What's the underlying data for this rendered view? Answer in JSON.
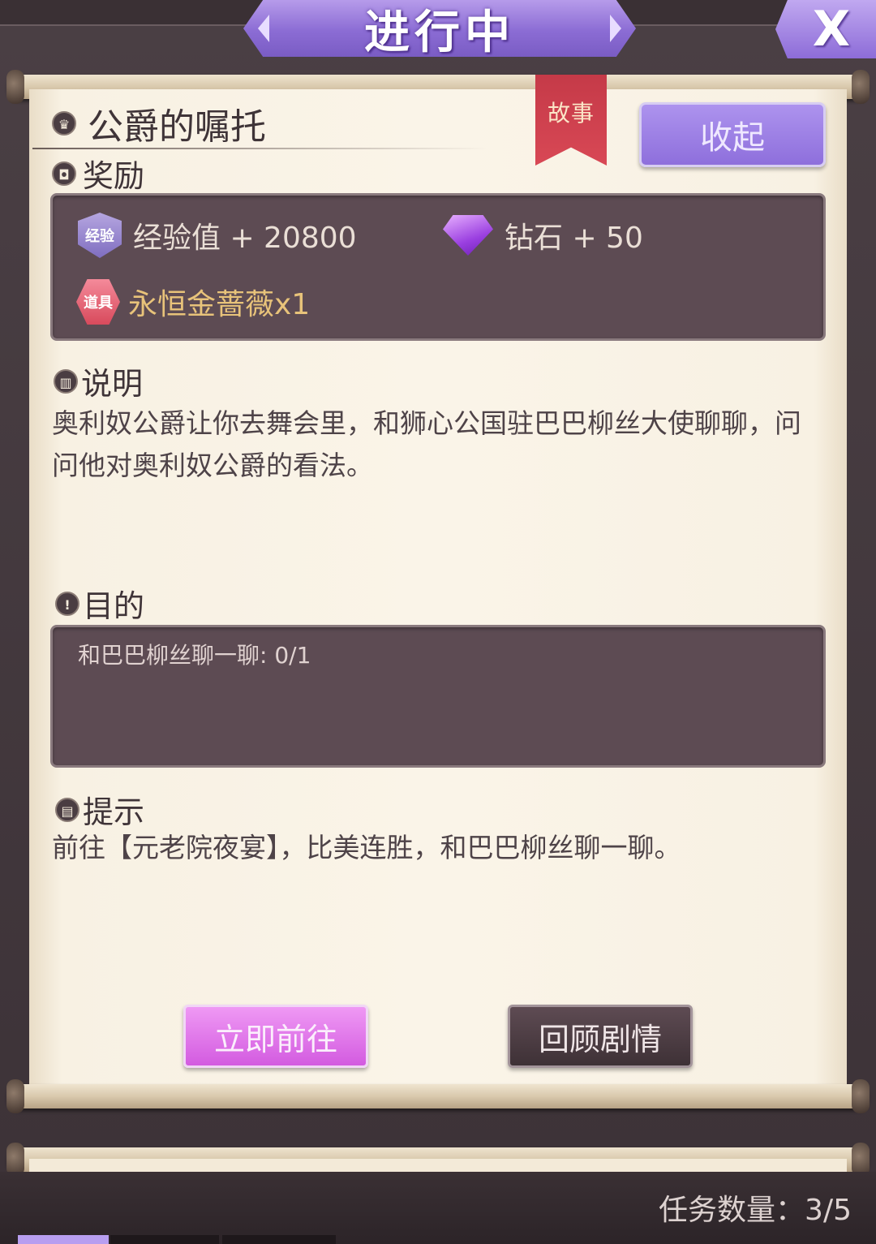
{
  "window": {
    "title": "进行中",
    "close_label": "X"
  },
  "quest": {
    "title": "公爵的嘱托",
    "category": "故事",
    "collapse_label": "收起"
  },
  "rewards": {
    "heading": "奖励",
    "items": [
      {
        "badge": "经验",
        "text": "经验值 + 20800",
        "icon": "exp-shield-icon"
      },
      {
        "badge": "",
        "text": "钻石 + 50",
        "icon": "diamond-icon"
      },
      {
        "badge": "道具",
        "text": "永恒金蔷薇x1",
        "icon": "item-badge-icon"
      }
    ]
  },
  "description": {
    "heading": "说明",
    "text": "奥利奴公爵让你去舞会里，和狮心公国驻巴巴柳丝大使聊聊，问问他对奥利奴公爵的看法。"
  },
  "objective": {
    "heading": "目的",
    "text": "和巴巴柳丝聊一聊: 0/1"
  },
  "hint": {
    "heading": "提示",
    "text": "前往【元老院夜宴】，比美连胜，和巴巴柳丝聊一聊。"
  },
  "actions": {
    "go_label": "立即前往",
    "review_label": "回顾剧情"
  },
  "footer": {
    "task_count": "任务数量：3/5"
  },
  "colors": {
    "accent_purple": "#8e6fdc",
    "go_pink": "#d35be0",
    "ribbon_red": "#c53a48",
    "paper": "#faf4e8",
    "dark_box": "#5d4b53"
  }
}
